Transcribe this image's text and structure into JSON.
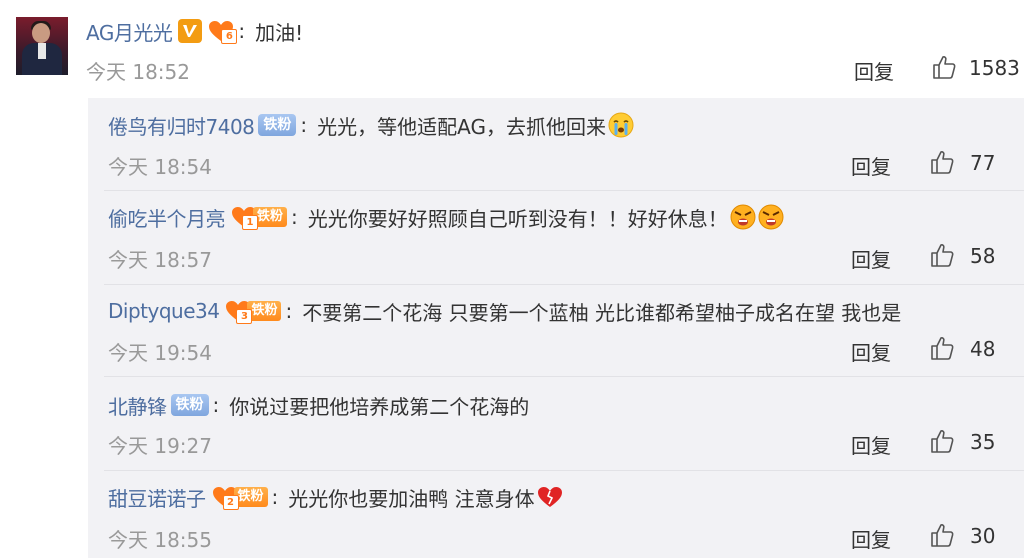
{
  "main": {
    "username": "AG月光光",
    "badge_level": "6",
    "comment": "加油!",
    "time": "今天 18:52",
    "reply_label": "回复",
    "likes": "1583"
  },
  "replies": [
    {
      "username": "倦鸟有归时7408",
      "fan_tag": "铁粉",
      "level": "",
      "text": "光光，等他适配AG，去抓他回来",
      "emoji": [
        "cry-emoji"
      ],
      "time": "今天 18:54",
      "reply_label": "回复",
      "likes": "77"
    },
    {
      "username": "偷吃半个月亮",
      "fan_tag": "铁粉",
      "level": "1",
      "text": "光光你要好好照顾自己听到没有！！好好休息！",
      "emoji": [
        "angry-emoji",
        "angry-emoji"
      ],
      "time": "今天 18:57",
      "reply_label": "回复",
      "likes": "58"
    },
    {
      "username": "Diptyque34",
      "fan_tag": "铁粉",
      "level": "3",
      "text": "不要第二个花海 只要第一个蓝柚 光比谁都希望柚子成名在望 我也是",
      "emoji": [],
      "time": "今天 19:54",
      "reply_label": "回复",
      "likes": "48"
    },
    {
      "username": "北静锋",
      "fan_tag": "铁粉",
      "level": "",
      "text": "你说过要把他培养成第二个花海的",
      "emoji": [],
      "time": "今天 19:27",
      "reply_label": "回复",
      "likes": "35"
    },
    {
      "username": "甜豆诺诺子",
      "fan_tag": "铁粉",
      "level": "2",
      "text": "光光你也要加油鸭 注意身体",
      "emoji": [
        "broken-heart-emoji"
      ],
      "time": "今天 18:55",
      "reply_label": "回复",
      "likes": "30"
    }
  ],
  "colors": {
    "username": "#4e6ea0",
    "fan_badge": "#8fb2e6",
    "level_badge": "#ff8a1c",
    "v_badge": "#f39c12",
    "reply_bg": "#f2f2f5"
  }
}
